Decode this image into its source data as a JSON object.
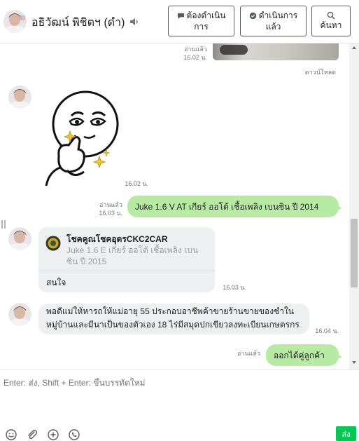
{
  "header": {
    "contact_name": "อธิวัฒน์ พิชิตฯ (ดำ)",
    "buttons": {
      "todo_l1": "ต้องดำเนิน",
      "todo_l2": "การ",
      "done_l1": "ดำเนินการ",
      "done_l2": "แล้ว",
      "search": "ค้นหา"
    }
  },
  "messages": {
    "m1": {
      "read": "อ่านแล้ว",
      "time": "16.02 น.",
      "download": "ดาวน์โหลด"
    },
    "m2": {
      "time": "16.02 น."
    },
    "m3": {
      "read": "อ่านแล้ว",
      "time": "16.03 น.",
      "text": "Juke 1.6 V AT   เกียร์ ออโต้  เชื้อเพลิง เบนซิน  ปี 2014"
    },
    "m4": {
      "card_title": "โชคคูณโชคอุดรCKC2CAR",
      "card_l1": "Juke 1.6 E   เกียร์ ออโต้  เชื้อเพลิง เบน",
      "card_l2": "ซิน  ปี 2015",
      "reply": "สนใจ",
      "time": "16.03 น."
    },
    "m5": {
      "l1": "พอดีแม่ให้หารถให้แม่อายุ 55 ประกอบอาชีพค้าขายร้านขายของชำใน",
      "l2": "หมู่บ้านและมีนาเป็นของตัวเอง 18 ไร่มีสมุดปกเขียวลงทะเบียนเกษตรกร",
      "time": "16.04 น."
    },
    "m6": {
      "read": "อ่านแล้ว",
      "text": "ออกได้คู่ลูกค้า"
    }
  },
  "composer": {
    "placeholder": "Enter: ส่ง, Shift + Enter: ขึ้นบรรทัดใหม่",
    "send_label": "ส่ง"
  },
  "colors": {
    "outgoing_bubble": "#b7eba3",
    "incoming_bubble": "#edeff1",
    "send_button": "#06c755"
  }
}
